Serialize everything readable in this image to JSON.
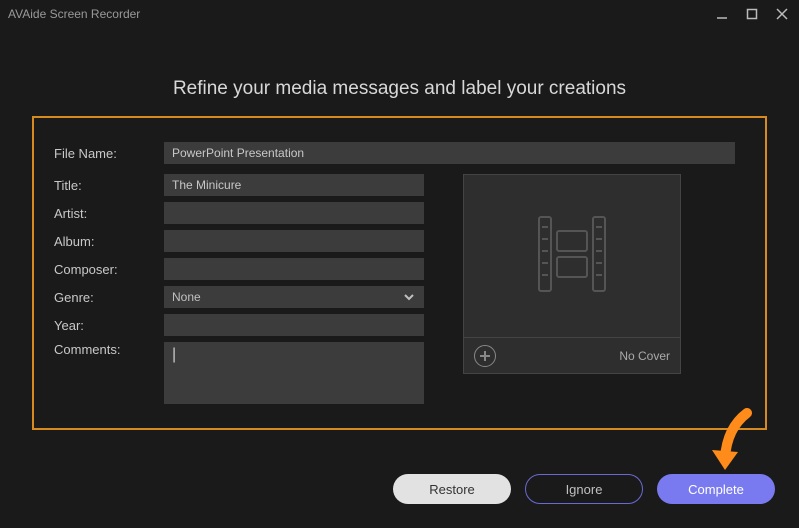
{
  "app_title": "AVAide Screen Recorder",
  "heading": "Refine your media messages and label your creations",
  "labels": {
    "file_name": "File Name:",
    "title": "Title:",
    "artist": "Artist:",
    "album": "Album:",
    "composer": "Composer:",
    "genre": "Genre:",
    "year": "Year:",
    "comments": "Comments:"
  },
  "values": {
    "file_name": "PowerPoint Presentation",
    "title": "The Minicure",
    "artist": "",
    "album": "",
    "composer": "",
    "genre": "None",
    "year": "",
    "comments": ""
  },
  "cover": {
    "no_cover": "No Cover"
  },
  "buttons": {
    "restore": "Restore",
    "ignore": "Ignore",
    "complete": "Complete"
  }
}
